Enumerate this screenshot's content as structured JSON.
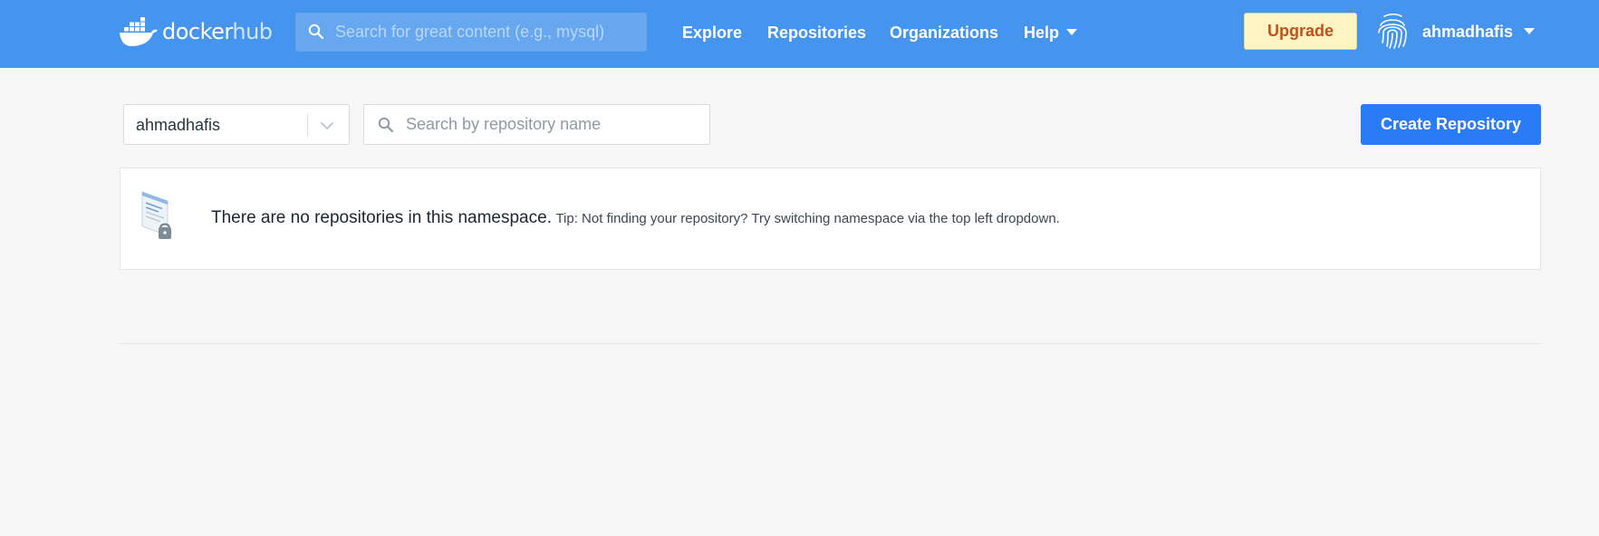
{
  "header": {
    "logo_docker": "docker",
    "logo_hub": "hub",
    "search_placeholder": "Search for great content (e.g., mysql)",
    "nav": {
      "explore": "Explore",
      "repositories": "Repositories",
      "organizations": "Organizations",
      "help": "Help"
    },
    "upgrade_label": "Upgrade",
    "username": "ahmadhafis"
  },
  "toolbar": {
    "namespace_selected": "ahmadhafis",
    "repo_search_placeholder": "Search by repository name",
    "create_label": "Create Repository"
  },
  "empty_state": {
    "message": "There are no repositories in this namespace.",
    "tip": "Tip: Not finding your repository? Try switching namespace via the top left dropdown."
  },
  "colors": {
    "header_bg": "#4594ed",
    "primary_button": "#2a7cf6",
    "upgrade_bg": "#fff4c3",
    "upgrade_text": "#c0521b",
    "page_bg": "#f6f6f6"
  },
  "icons": [
    "docker-whale-icon",
    "search-icon",
    "caret-down-icon",
    "fingerprint-avatar-icon",
    "chevron-down-icon",
    "repository-locked-illustration"
  ]
}
